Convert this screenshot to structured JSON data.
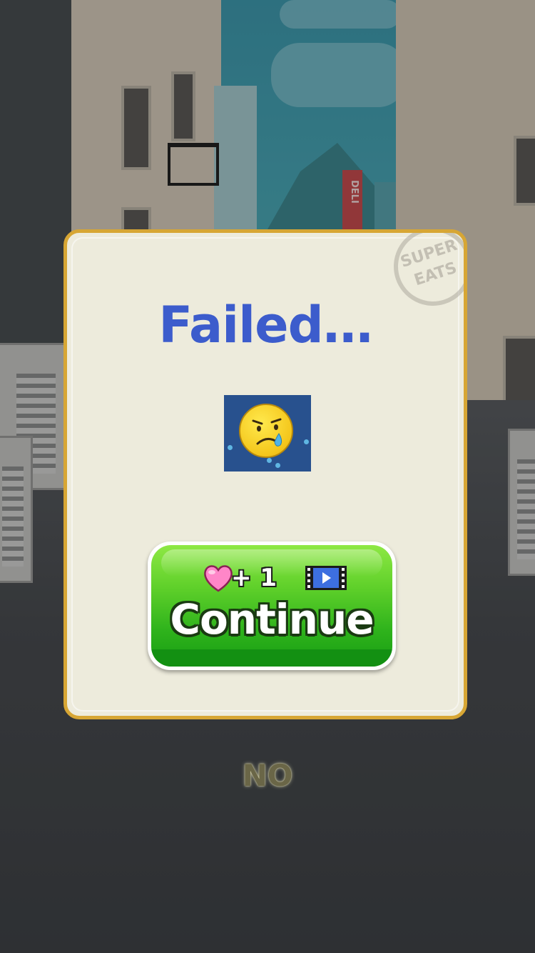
{
  "dialog": {
    "title": "Failed…",
    "stamp": {
      "line1": "SUPER",
      "line2": "EATS"
    },
    "result_emoji": "crying-face-icon"
  },
  "continue_button": {
    "reward_icon": "heart-icon",
    "reward_text": "+ 1",
    "ad_icon": "video-icon",
    "label": "Continue",
    "color": "#2fb31c"
  },
  "no_button": {
    "label": "NO"
  },
  "scene": {
    "sign_text": "DELI"
  },
  "colors": {
    "title": "#3c5ccc",
    "dialog_bg": "#edebdc",
    "dialog_border": "#d7a634",
    "heart": "#ff7fc2"
  }
}
